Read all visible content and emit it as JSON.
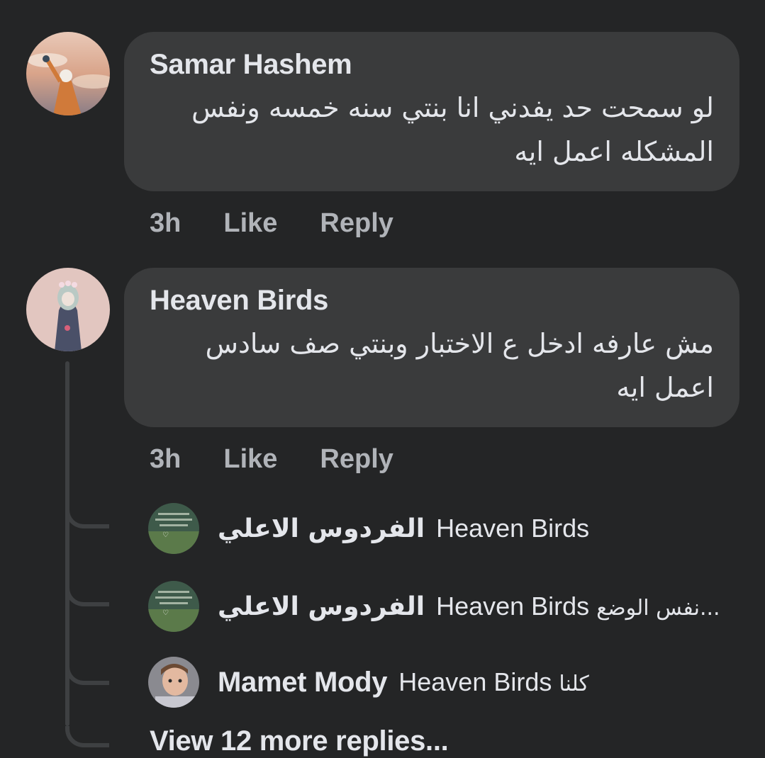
{
  "comments": [
    {
      "author": "Samar Hashem",
      "text": "لو سمحت حد يفدني انا بنتي سنه خمسه ونفس المشكله اعمل ايه",
      "time": "3h",
      "like_label": "Like",
      "reply_label": "Reply"
    },
    {
      "author": "Heaven Birds",
      "text": "مش عارفه ادخل ع الاختبار وبنتي صف سادس اعمل ايه",
      "time": "3h",
      "like_label": "Like",
      "reply_label": "Reply"
    }
  ],
  "replies": [
    {
      "author": "الفردوس الاعلي",
      "mention": "Heaven Birds",
      "text": ""
    },
    {
      "author": "الفردوس الاعلي",
      "mention": "Heaven Birds",
      "text": "نفس الوضع..."
    },
    {
      "author": "Mamet Mody",
      "mention": "Heaven Birds",
      "text": "كلنا"
    }
  ],
  "view_more_label": "View 12 more replies...",
  "colors": {
    "background": "#242526",
    "bubble": "#3a3b3c",
    "primary_text": "#e4e6eb",
    "secondary_text": "#b0b3b8",
    "thread_line": "#3e4042"
  }
}
